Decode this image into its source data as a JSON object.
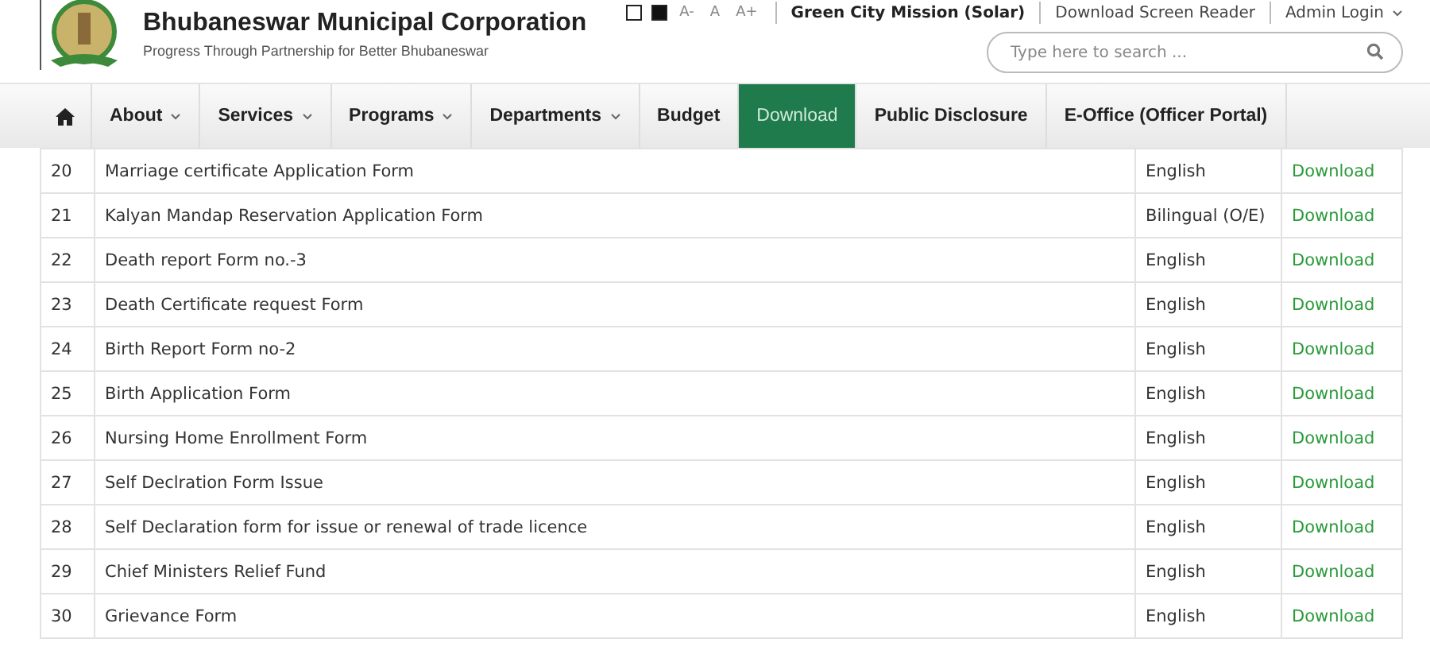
{
  "header": {
    "title": "Bhubaneswar Municipal Corporation",
    "tagline": "Progress Through Partnership for Better Bhubaneswar"
  },
  "top_bar": {
    "font_sizes": [
      "A-",
      "A",
      "A+"
    ],
    "links": [
      {
        "label": "Green City Mission (Solar)",
        "kind": "bold"
      },
      {
        "label": "Download Screen Reader",
        "kind": "plain"
      },
      {
        "label": "Admin Login",
        "kind": "dropdown"
      }
    ]
  },
  "search": {
    "placeholder": "Type here to search ..."
  },
  "nav": [
    {
      "label": "About",
      "dropdown": true,
      "selected": false
    },
    {
      "label": "Services",
      "dropdown": true,
      "selected": false
    },
    {
      "label": "Programs",
      "dropdown": true,
      "selected": false
    },
    {
      "label": "Departments",
      "dropdown": true,
      "selected": false
    },
    {
      "label": "Budget",
      "dropdown": false,
      "selected": false
    },
    {
      "label": "Download",
      "dropdown": false,
      "selected": true
    },
    {
      "label": "Public Disclosure",
      "dropdown": false,
      "selected": false
    },
    {
      "label": "E-Office (Officer Portal)",
      "dropdown": false,
      "selected": false
    }
  ],
  "table": {
    "rows": [
      {
        "number": "20",
        "title": "Marriage certificate Application Form",
        "language": "English",
        "link": "Download"
      },
      {
        "number": "21",
        "title": "Kalyan Mandap Reservation Application Form",
        "language": "Bilingual (O/E)",
        "link": "Download"
      },
      {
        "number": "22",
        "title": "Death report Form no.-3",
        "language": "English",
        "link": "Download"
      },
      {
        "number": "23",
        "title": "Death Certificate request Form",
        "language": "English",
        "link": "Download"
      },
      {
        "number": "24",
        "title": "Birth Report Form no-2",
        "language": "English",
        "link": "Download"
      },
      {
        "number": "25",
        "title": "Birth Application Form",
        "language": "English",
        "link": "Download"
      },
      {
        "number": "26",
        "title": "Nursing Home Enrollment Form",
        "language": "English",
        "link": "Download"
      },
      {
        "number": "27",
        "title": "Self Declration Form Issue",
        "language": "English",
        "link": "Download"
      },
      {
        "number": "28",
        "title": "Self Declaration form for issue or renewal of trade licence",
        "language": "English",
        "link": "Download"
      },
      {
        "number": "29",
        "title": "Chief Ministers Relief Fund",
        "language": "English",
        "link": "Download"
      },
      {
        "number": "30",
        "title": "Grievance Form",
        "language": "English",
        "link": "Download"
      }
    ]
  }
}
